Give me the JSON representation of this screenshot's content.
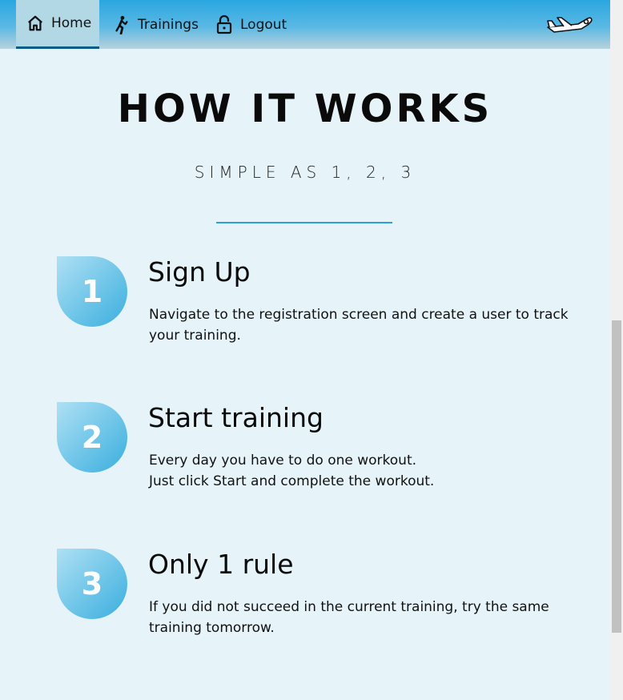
{
  "nav": {
    "items": [
      {
        "label": "Home",
        "icon": "home-icon",
        "active": true
      },
      {
        "label": "Trainings",
        "icon": "runner-icon",
        "active": false
      },
      {
        "label": "Logout",
        "icon": "lock-icon",
        "active": false
      }
    ],
    "logo_icon": "airplane-logo-icon"
  },
  "hero": {
    "title": "HOW IT WORKS",
    "subtitle": "SIMPLE AS 1, 2, 3"
  },
  "steps": [
    {
      "number": "1",
      "title": "Sign Up",
      "line1": "Navigate to the registration screen and create a user to track your training.",
      "line2": ""
    },
    {
      "number": "2",
      "title": "Start training",
      "line1": "Every day you have to do one workout.",
      "line2": "Just click Start and complete the workout."
    },
    {
      "number": "3",
      "title": "Only 1 rule",
      "line1": "If you did not succeed in the current training, try the same training tomorrow.",
      "line2": ""
    }
  ],
  "colors": {
    "background": "#e6f4f9",
    "accent": "#2c9fd3",
    "nav_active": "#b2d8e6"
  }
}
